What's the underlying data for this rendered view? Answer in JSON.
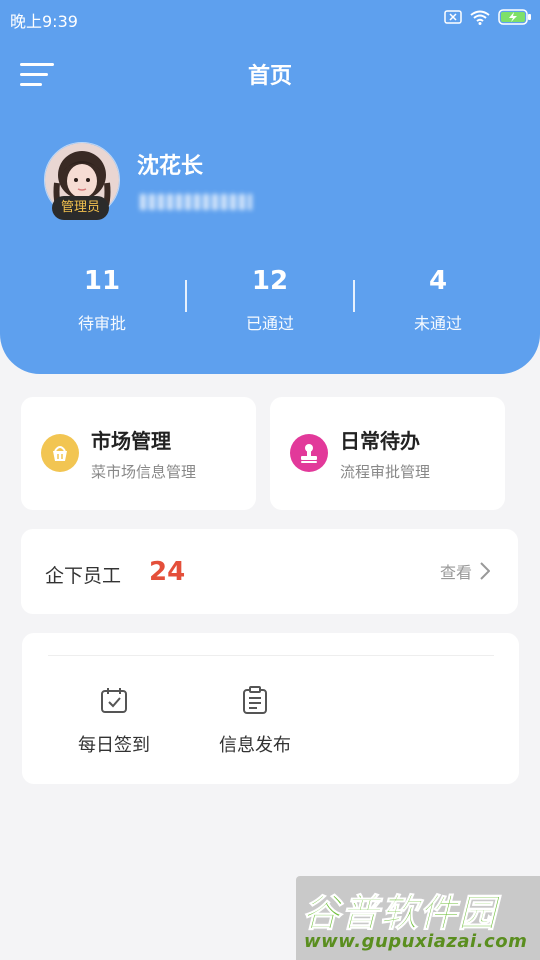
{
  "status_bar": {
    "time": "晚上9:39"
  },
  "nav": {
    "title": "首页"
  },
  "profile": {
    "name": "沈花长",
    "role": "管理员",
    "phone": ""
  },
  "stats": [
    {
      "value": "11",
      "label": "待审批"
    },
    {
      "value": "12",
      "label": "已通过"
    },
    {
      "value": "4",
      "label": "未通过"
    }
  ],
  "features": [
    {
      "title": "市场管理",
      "subtitle": "菜市场信息管理",
      "icon": "basket-icon",
      "color": "#f2c552"
    },
    {
      "title": "日常待办",
      "subtitle": "流程审批管理",
      "icon": "stamp-icon",
      "color": "#e2399a"
    }
  ],
  "staff": {
    "label": "企下员工",
    "count": "24",
    "link": "查看"
  },
  "tools": [
    {
      "label": "每日签到",
      "icon": "calendar-check-icon"
    },
    {
      "label": "信息发布",
      "icon": "clipboard-icon"
    }
  ],
  "watermark": {
    "title": "谷普软件园",
    "url": "www.gupuxiazai.com"
  },
  "colors": {
    "header": "#5ea0ee",
    "accent_number": "#e44f3a",
    "background": "#f4f4f6"
  }
}
